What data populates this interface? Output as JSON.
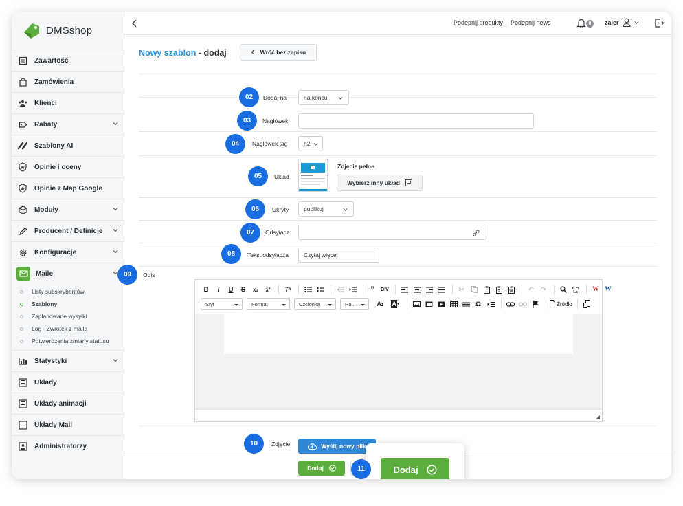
{
  "brand": {
    "name": "DMSshop",
    "color": "#5cae3c"
  },
  "sidebar": {
    "items": [
      {
        "label": "Zawartość",
        "icon": "content-icon",
        "has_children": false
      },
      {
        "label": "Zamówienia",
        "icon": "bag-icon",
        "has_children": false
      },
      {
        "label": "Klienci",
        "icon": "users-icon",
        "has_children": false
      },
      {
        "label": "Rabaty",
        "icon": "tag-icon",
        "has_children": true
      },
      {
        "label": "Szablony AI",
        "icon": "ai-icon",
        "has_children": false
      },
      {
        "label": "Opinie i oceny",
        "icon": "star-shield-icon",
        "has_children": false
      },
      {
        "label": "Opinie z Map Google",
        "icon": "star-shield-icon",
        "has_children": false
      },
      {
        "label": "Moduły",
        "icon": "cube-icon",
        "has_children": true
      },
      {
        "label": "Producent / Definicje",
        "icon": "pencil-icon",
        "has_children": true
      },
      {
        "label": "Konfiguracje",
        "icon": "gear-icon",
        "has_children": true
      },
      {
        "label": "Maile",
        "icon": "mail-icon",
        "has_children": true,
        "active": true
      },
      {
        "label": "Statystyki",
        "icon": "bar-chart-icon",
        "has_children": true
      },
      {
        "label": "Układy",
        "icon": "layout-icon",
        "has_children": false
      },
      {
        "label": "Układy animacji",
        "icon": "layout-icon",
        "has_children": false
      },
      {
        "label": "Układy Mail",
        "icon": "layout-icon",
        "has_children": false
      },
      {
        "label": "Administratorzy",
        "icon": "admin-icon",
        "has_children": false
      }
    ],
    "submenu": [
      "Listy subskrybentów",
      "Szablony",
      "Zaplanowane wysyłki",
      "Log - Zwrotek z maila",
      "Potwierdzenia zmiany statusu"
    ],
    "submenu_current": "Szablony"
  },
  "topbar": {
    "link1": "Podepnij produkty",
    "link2": "Podepnij news",
    "notifications": "0",
    "user": "zaler"
  },
  "page": {
    "title_blue": "Nowy szablon",
    "title_rest": " - dodaj",
    "back_button": "Wróć bez zapisu"
  },
  "form": {
    "dodaj_na": {
      "badge": "02",
      "label": "Dodaj na",
      "value": "na końcu"
    },
    "naglowek": {
      "badge": "03",
      "label": "Nagłówek",
      "value": ""
    },
    "naglowek_tag": {
      "badge": "04",
      "label": "Nagłówek tag",
      "value": "h2"
    },
    "uklad": {
      "badge": "05",
      "label": "Układ",
      "layout_name": "Zdjęcie pełne",
      "button": "Wybierz inny układ"
    },
    "ukryty": {
      "badge": "06",
      "label": "Ukryty",
      "value": "publikuj"
    },
    "odsylacz": {
      "badge": "07",
      "label": "Odsyłacz",
      "value": ""
    },
    "tekst_odsylacza": {
      "badge": "08",
      "label": "Tekst odsyłacza",
      "value": "Czytaj więcej"
    },
    "opis": {
      "badge": "09",
      "label": "Opis"
    },
    "zdjecie": {
      "badge": "10",
      "label": "Zdjęcie",
      "button": "Wyślij nowy plik"
    }
  },
  "editor": {
    "selects": {
      "style": "Styl",
      "format": "Format",
      "font": "Czcionka",
      "size": "Ro..."
    },
    "source": "Źródło",
    "text_color_glyph": "A",
    "bg_color_glyph": "A",
    "special_char_glyph": "Ω"
  },
  "footer": {
    "add": "Dodaj",
    "badge": "11",
    "add_zoomed": "Dodaj"
  },
  "colors": {
    "accent_blue": "#2a8fd6",
    "badge_blue": "#1a6de0",
    "button_green": "#5cae3c",
    "upload_blue": "#2f87d8"
  }
}
